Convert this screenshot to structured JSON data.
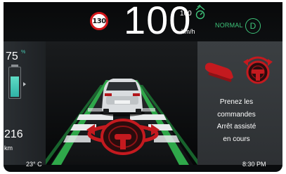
{
  "cluster": {
    "speed_limit": "130",
    "speed": "100",
    "speed_unit": "km/h",
    "set_speed": "100",
    "drive_mode": "NORMAL",
    "gear": "D"
  },
  "battery": {
    "percent": "75",
    "percent_unit": "%",
    "level": 0.75,
    "range": "216",
    "range_unit": "km"
  },
  "alert": {
    "line1": "Prenez les",
    "line2": "commandes",
    "line3": "Arrêt assisté",
    "line4": "en cours"
  },
  "status": {
    "temperature": "23° C",
    "time": "8:30 PM"
  },
  "icons": [
    "adaptive-cruise-icon",
    "foot-on-pedal-icon",
    "steering-wheel-warning-icon",
    "car-icon",
    "lane-marking-icon"
  ],
  "colors": {
    "accent_green": "#3ec47a",
    "warning_red": "#d4171b",
    "battery_teal": "#4ecbb8"
  }
}
